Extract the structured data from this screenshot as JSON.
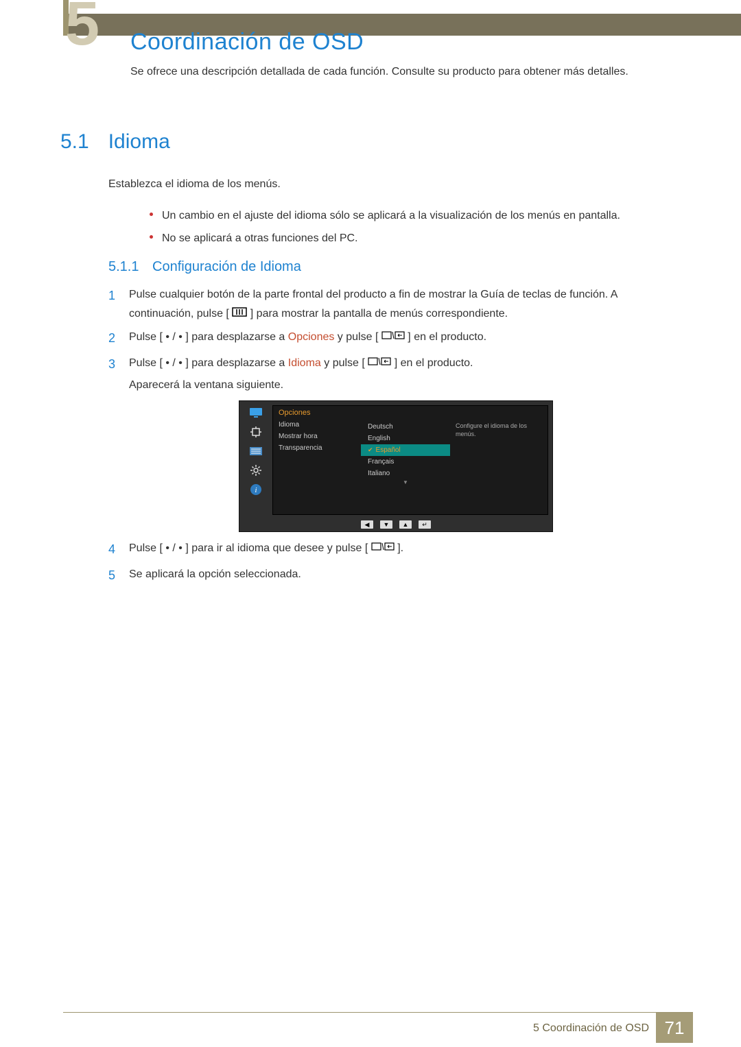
{
  "chapter": {
    "bignum": "5",
    "title": "Coordinación de OSD",
    "intro": "Se ofrece una descripción detallada de cada función. Consulte su producto para obtener más detalles."
  },
  "section": {
    "num": "5.1",
    "title": "Idioma",
    "lead": "Establezca el idioma de los menús.",
    "bullets": [
      "Un cambio en el ajuste del idioma sólo se aplicará a la visualización de los menús en pantalla.",
      "No se aplicará a otras funciones del PC."
    ]
  },
  "subsection": {
    "num": "5.1.1",
    "title": "Configuración de Idioma"
  },
  "steps": {
    "s1_a": "Pulse cualquier botón de la parte frontal del producto a fin de mostrar la Guía de teclas de función. A continuación, pulse [",
    "s1_b": "] para mostrar la pantalla de menús correspondiente.",
    "s2_a": "Pulse [ • / • ] para desplazarse a ",
    "s2_hl": "Opciones",
    "s2_b": " y pulse [",
    "s2_c": "] en el producto.",
    "s3_a": "Pulse [ • / • ] para desplazarse a ",
    "s3_hl": "Idioma",
    "s3_b": " y pulse [",
    "s3_c": "] en el producto.",
    "s3_d": "Aparecerá la ventana siguiente.",
    "s4_a": "Pulse [ • / • ] para ir al idioma que desee y pulse [",
    "s4_b": "].",
    "s5": "Se aplicará la opción seleccionada."
  },
  "osd": {
    "title": "Opciones",
    "menu": [
      "Idioma",
      "Mostrar hora",
      "Transparencia"
    ],
    "languages": [
      "Deutsch",
      "English",
      "Español",
      "Français",
      "Italiano"
    ],
    "selectedIndex": "2",
    "hint": "Configure el idioma de los menús.",
    "moreIndicator": "▼"
  },
  "footer": {
    "label": "5 Coordinación de OSD",
    "page": "71"
  }
}
